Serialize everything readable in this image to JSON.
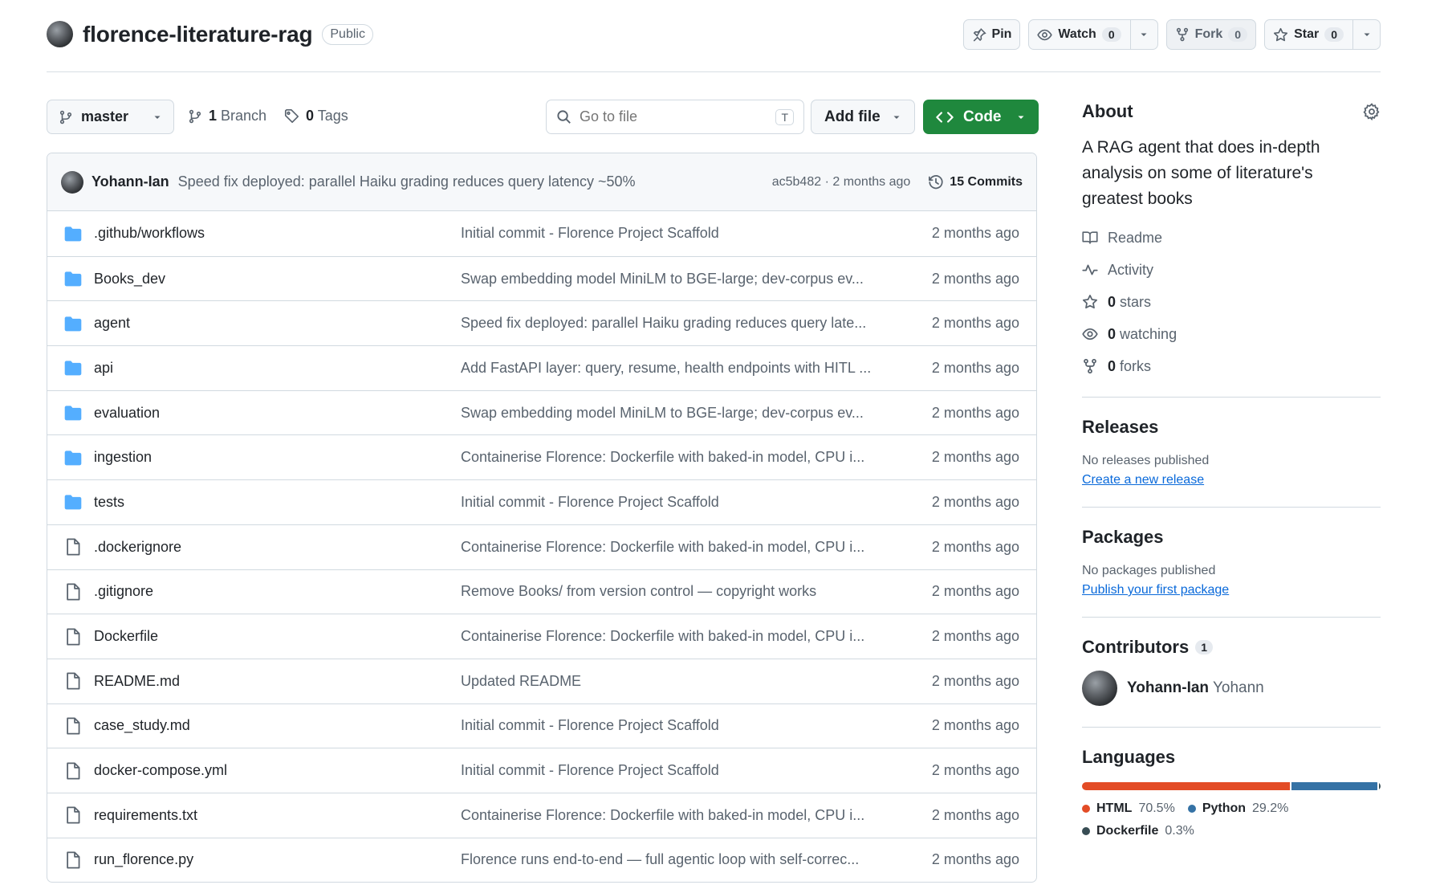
{
  "repo": {
    "name": "florence-literature-rag",
    "visibility": "Public"
  },
  "header_actions": {
    "pin_label": "Pin",
    "watch_label": "Watch",
    "watch_count": "0",
    "fork_label": "Fork",
    "fork_count": "0",
    "star_label": "Star",
    "star_count": "0"
  },
  "file_nav": {
    "branch": "master",
    "branches_count": "1",
    "branches_label": "Branch",
    "tags_count": "0",
    "tags_label": "Tags",
    "goto_placeholder": "Go to file",
    "goto_shortcut": "T",
    "add_file_label": "Add file",
    "code_label": "Code"
  },
  "latest_commit": {
    "author": "Yohann-Ian",
    "message": "Speed fix deployed: parallel Haiku grading reduces query latency ~50%",
    "meta": "ac5b482 · 2 months ago",
    "commits_label": "15 Commits"
  },
  "files": [
    {
      "type": "dir",
      "name": ".github/workflows",
      "commit": "Initial commit - Florence Project Scaffold",
      "date": "2 months ago"
    },
    {
      "type": "dir",
      "name": "Books_dev",
      "commit": "Swap embedding model MiniLM to BGE-large; dev-corpus ev...",
      "date": "2 months ago"
    },
    {
      "type": "dir",
      "name": "agent",
      "commit": "Speed fix deployed: parallel Haiku grading reduces query late...",
      "date": "2 months ago"
    },
    {
      "type": "dir",
      "name": "api",
      "commit": "Add FastAPI layer: query, resume, health endpoints with HITL ...",
      "date": "2 months ago"
    },
    {
      "type": "dir",
      "name": "evaluation",
      "commit": "Swap embedding model MiniLM to BGE-large; dev-corpus ev...",
      "date": "2 months ago"
    },
    {
      "type": "dir",
      "name": "ingestion",
      "commit": "Containerise Florence: Dockerfile with baked-in model, CPU i...",
      "date": "2 months ago"
    },
    {
      "type": "dir",
      "name": "tests",
      "commit": "Initial commit - Florence Project Scaffold",
      "date": "2 months ago"
    },
    {
      "type": "file",
      "name": ".dockerignore",
      "commit": "Containerise Florence: Dockerfile with baked-in model, CPU i...",
      "date": "2 months ago"
    },
    {
      "type": "file",
      "name": ".gitignore",
      "commit": "Remove Books/ from version control — copyright works",
      "date": "2 months ago"
    },
    {
      "type": "file",
      "name": "Dockerfile",
      "commit": "Containerise Florence: Dockerfile with baked-in model, CPU i...",
      "date": "2 months ago"
    },
    {
      "type": "file",
      "name": "README.md",
      "commit": "Updated README",
      "date": "2 months ago"
    },
    {
      "type": "file",
      "name": "case_study.md",
      "commit": "Initial commit - Florence Project Scaffold",
      "date": "2 months ago"
    },
    {
      "type": "file",
      "name": "docker-compose.yml",
      "commit": "Initial commit - Florence Project Scaffold",
      "date": "2 months ago"
    },
    {
      "type": "file",
      "name": "requirements.txt",
      "commit": "Containerise Florence: Dockerfile with baked-in model, CPU i...",
      "date": "2 months ago"
    },
    {
      "type": "file",
      "name": "run_florence.py",
      "commit": "Florence runs end-to-end — full agentic loop with self-correc...",
      "date": "2 months ago"
    }
  ],
  "about": {
    "title": "About",
    "description": "A RAG agent that does in-depth analysis on some of literature's greatest books",
    "readme_label": "Readme",
    "activity_label": "Activity",
    "stars_count": "0",
    "stars_label": "stars",
    "watching_count": "0",
    "watching_label": "watching",
    "forks_count": "0",
    "forks_label": "forks"
  },
  "releases": {
    "title": "Releases",
    "empty_text": "No releases published",
    "create_link": "Create a new release"
  },
  "packages": {
    "title": "Packages",
    "empty_text": "No packages published",
    "publish_link": "Publish your first package"
  },
  "contributors": {
    "title": "Contributors",
    "count": "1",
    "items": [
      {
        "login": "Yohann-Ian",
        "name": "Yohann"
      }
    ]
  },
  "languages": {
    "title": "Languages",
    "items": [
      {
        "name": "HTML",
        "percent": 70.5,
        "label": "70.5%",
        "color": "#e34c26"
      },
      {
        "name": "Python",
        "percent": 29.2,
        "label": "29.2%",
        "color": "#3572a5"
      },
      {
        "name": "Dockerfile",
        "percent": 0.3,
        "label": "0.3%",
        "color": "#384d54"
      }
    ]
  },
  "colors": {
    "accent_green": "#1f883d",
    "link_blue": "#0969da",
    "folder_blue": "#54aeff"
  }
}
